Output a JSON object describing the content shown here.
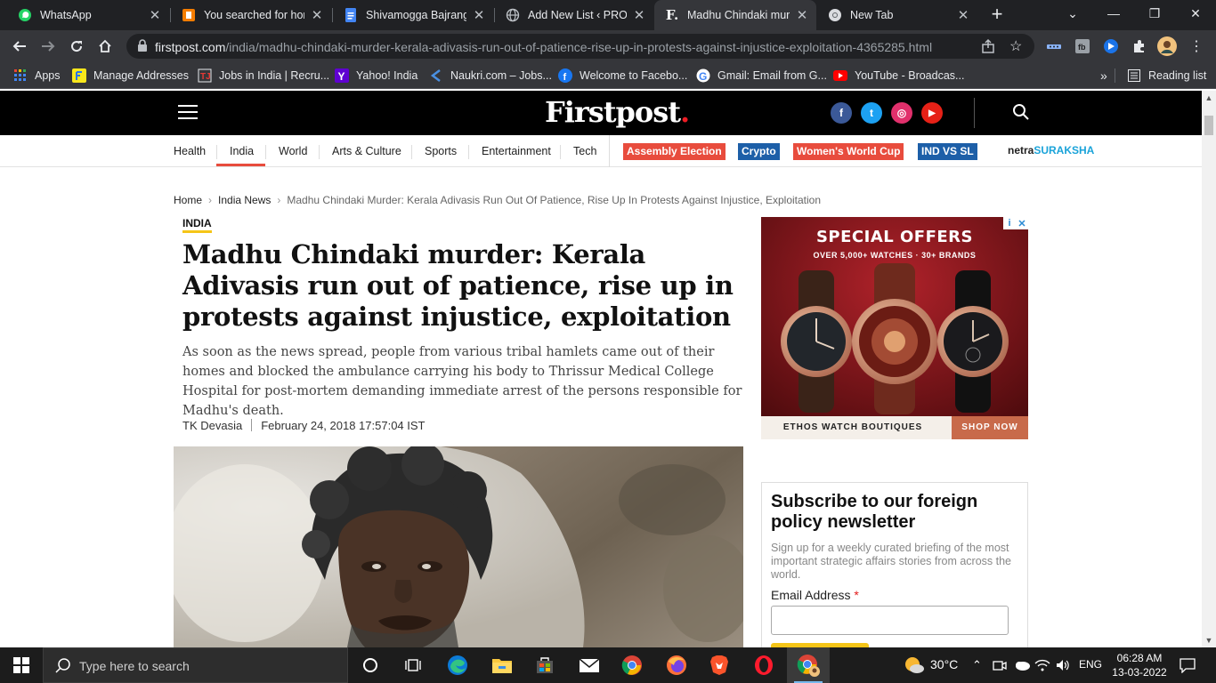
{
  "browser": {
    "tabs": [
      {
        "title": "WhatsApp",
        "favicon": "whatsapp-icon"
      },
      {
        "title": "You searched for hom",
        "favicon": "blogger-icon"
      },
      {
        "title": "Shivamogga Bajrang D",
        "favicon": "docs-icon"
      },
      {
        "title": "Add New List ‹ PROJEC",
        "favicon": "globe-icon"
      },
      {
        "title": "Madhu Chindaki murde",
        "favicon": "firstpost-icon",
        "active": true
      },
      {
        "title": "New Tab",
        "favicon": "chrome-icon"
      }
    ],
    "new_tab_label": "+",
    "url_host": "firstpost.com",
    "url_path": "/india/madhu-chindaki-murder-kerala-adivasis-run-out-of-patience-rise-up-in-protests-against-injustice-exploitation-4365285.html",
    "bookmarks": [
      {
        "label": "Apps",
        "icon": "apps-grid-icon"
      },
      {
        "label": "Manage Addresses",
        "icon": "flipkart-icon"
      },
      {
        "label": "Jobs in India | Recru...",
        "icon": "timesjobs-icon"
      },
      {
        "label": "Yahoo! India",
        "icon": "yahoo-icon"
      },
      {
        "label": "Naukri.com – Jobs...",
        "icon": "naukri-icon"
      },
      {
        "label": "Welcome to Facebo...",
        "icon": "facebook-icon"
      },
      {
        "label": "Gmail: Email from G...",
        "icon": "google-icon"
      },
      {
        "label": "YouTube - Broadcas...",
        "icon": "youtube-icon"
      }
    ],
    "bookmarks_overflow": "»",
    "reading_list": "Reading list"
  },
  "site": {
    "logo_text": "Firstpost",
    "logo_dot": ".",
    "social": [
      {
        "name": "facebook",
        "glyph": "f",
        "color": "#3b5998"
      },
      {
        "name": "twitter",
        "glyph": "t",
        "color": "#1da1f2"
      },
      {
        "name": "instagram",
        "glyph": "◎",
        "color": "#e1306c"
      },
      {
        "name": "youtube",
        "glyph": "▶",
        "color": "#e62117"
      }
    ],
    "categories": [
      "Health",
      "India",
      "World",
      "Arts & Culture",
      "Sports",
      "Entertainment",
      "Tech"
    ],
    "active_category": "India",
    "highlight_pills": [
      {
        "label": "Assembly Election",
        "color": "#e84c3d"
      },
      {
        "label": "Crypto",
        "color": "#1d5fa8"
      },
      {
        "label": "Women's World Cup",
        "color": "#e84c3d"
      },
      {
        "label": "IND VS SL",
        "color": "#1d5fa8"
      }
    ],
    "partner": {
      "part1": "netra",
      "part2": "SURAKSHA"
    }
  },
  "article": {
    "breadcrumb": [
      "Home",
      "India News",
      "Madhu Chindaki Murder: Kerala Adivasis Run Out Of Patience, Rise Up In Protests Against Injustice, Exploitation"
    ],
    "section_tag": "INDIA",
    "headline": "Madhu Chindaki murder: Kerala Adivasis run out of patience, rise up in protests against injustice, exploitation",
    "summary": "As soon as the news spread, people from various tribal hamlets came out of their homes and blocked the ambulance carrying his body to Thrissur Medical College Hospital for post-mortem demanding immediate arrest of the persons responsible for Madhu's death.",
    "author": "TK Devasia",
    "date": "February 24, 2018 17:57:04 IST"
  },
  "ad": {
    "headline": "SPECIAL OFFERS",
    "subline": "OVER 5,000+ WATCHES · 30+ BRANDS",
    "brand": "ETHOS WATCH BOUTIQUES",
    "cta": "SHOP NOW"
  },
  "newsletter": {
    "title": "Subscribe to our foreign policy newsletter",
    "description": "Sign up for a weekly curated briefing of the most important strategic affairs stories from across the world.",
    "email_label": "Email Address",
    "required_mark": "*"
  },
  "taskbar": {
    "search_placeholder": "Type here to search",
    "weather": "30°C",
    "language": "ENG",
    "time": "06:28 AM",
    "date": "13-03-2022"
  }
}
